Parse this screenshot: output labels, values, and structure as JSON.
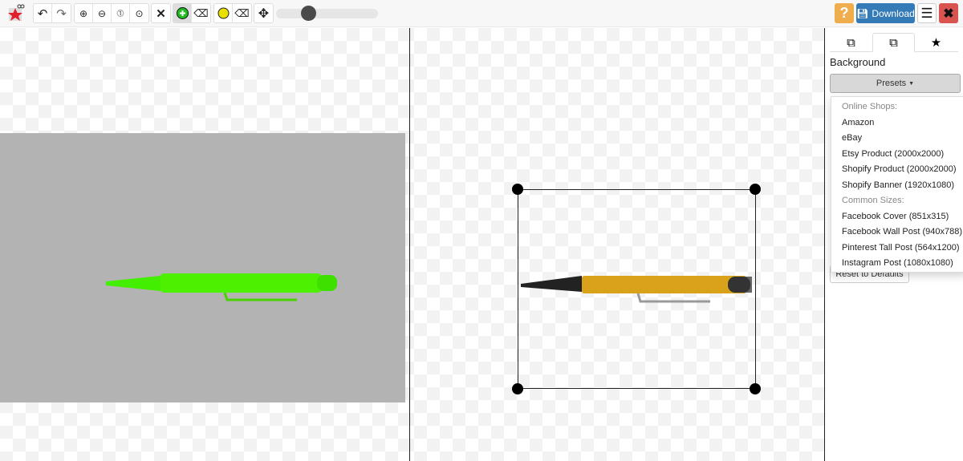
{
  "toolbar": {
    "logo": "app-logo",
    "tools": [
      "undo",
      "redo",
      "zoom-in",
      "zoom-out",
      "zoom-actual",
      "zoom-fit",
      "clear",
      "keep-brush",
      "erase-brush",
      "hair-brush",
      "hair-eraser",
      "pan"
    ],
    "brush_size_fraction": 0.32,
    "help_label": "?",
    "download_label": "Download",
    "colors": {
      "help": "#f0ad4e",
      "download": "#337ab7",
      "close": "#d9534f"
    }
  },
  "side": {
    "tabs": [
      "layers-icon",
      "copy-icon",
      "star-icon"
    ],
    "active_tab": 1,
    "section_title": "Background",
    "presets_label": "Presets",
    "reset_label": "Reset to Defaults",
    "menu": [
      {
        "label": "Online Shops:",
        "header": true
      },
      {
        "label": "Amazon"
      },
      {
        "label": "eBay"
      },
      {
        "label": "Etsy Product (2000x2000)"
      },
      {
        "label": "Shopify Product (2000x2000)"
      },
      {
        "label": "Shopify Banner (1920x1080)"
      },
      {
        "label": "Common Sizes:",
        "header": true
      },
      {
        "label": "Facebook Cover (851x315)"
      },
      {
        "label": "Facebook Wall Post (940x788)"
      },
      {
        "label": "Pinterest Tall Post (564x1200)"
      },
      {
        "label": "Instagram Post (1080x1080)"
      }
    ]
  }
}
